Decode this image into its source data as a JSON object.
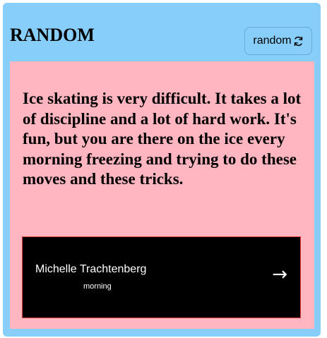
{
  "header": {
    "title": "RANDOM",
    "random_button_label": "random",
    "random_button_icon": "refresh-icon"
  },
  "quote": {
    "text": "Ice skating is very difficult. It takes a lot of discipline and a lot of hard work. It's fun, but you are there on the ice every morning freezing and trying to do these moves and these tricks.",
    "author": "Michelle Trachtenberg",
    "tag": "morning",
    "next_icon": "arrow-right-icon"
  },
  "colors": {
    "card_background": "#87cefa",
    "quote_background": "#ffb6c1",
    "author_box_background": "#000000",
    "author_box_border": "#e03b3b"
  }
}
